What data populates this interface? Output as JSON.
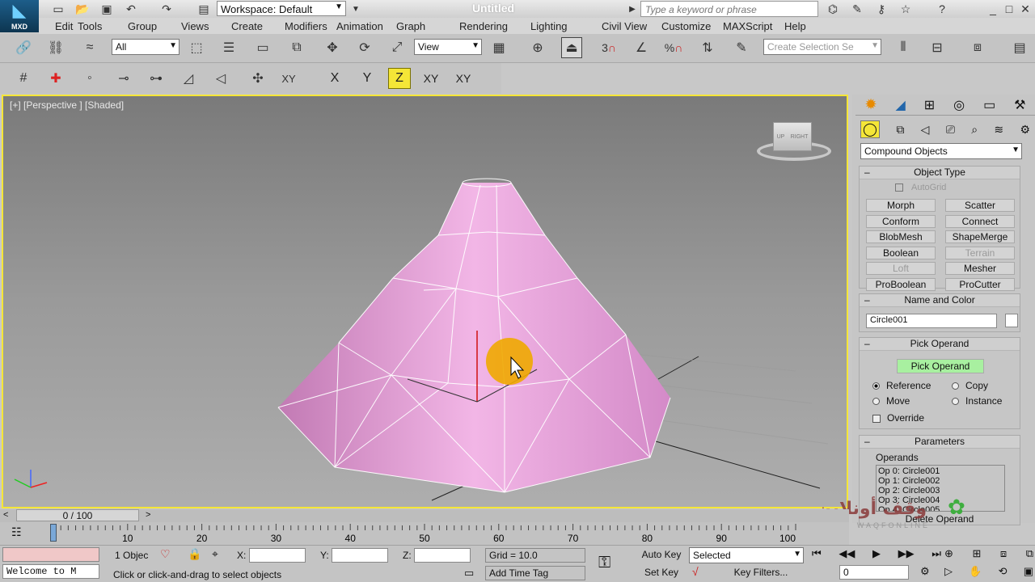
{
  "titlebar": {
    "app_badge": "MXD",
    "workspace": "Workspace: Default",
    "doc_title": "Untitled",
    "search_placeholder": "Type a keyword or phrase"
  },
  "menu": [
    "Edit",
    "Tools",
    "Group",
    "Views",
    "Create",
    "Modifiers",
    "Animation",
    "Graph Editors",
    "Rendering",
    "Lighting Analysis",
    "Civil View",
    "Customize",
    "MAXScript",
    "Help"
  ],
  "toolbar": {
    "filter_value": "All",
    "ref_coord_value": "View",
    "selection_set_placeholder": "Create Selection Se",
    "snap_label": "3",
    "percent_label": "%",
    "axes": [
      "X",
      "Y",
      "Z",
      "XY",
      "XY"
    ]
  },
  "viewport": {
    "label": "[+] [Perspective ] [Shaded]",
    "viewcube_labels": [
      "UP",
      "RIGHT"
    ]
  },
  "panel": {
    "category": "Compound Objects",
    "object_type": {
      "title": "Object Type",
      "autogrid": "AutoGrid",
      "buttons": [
        {
          "label": "Morph",
          "enabled": true
        },
        {
          "label": "Scatter",
          "enabled": true
        },
        {
          "label": "Conform",
          "enabled": true
        },
        {
          "label": "Connect",
          "enabled": true
        },
        {
          "label": "BlobMesh",
          "enabled": true
        },
        {
          "label": "ShapeMerge",
          "enabled": true
        },
        {
          "label": "Boolean",
          "enabled": true
        },
        {
          "label": "Terrain",
          "enabled": false
        },
        {
          "label": "Loft",
          "enabled": false
        },
        {
          "label": "Mesher",
          "enabled": true
        },
        {
          "label": "ProBoolean",
          "enabled": true
        },
        {
          "label": "ProCutter",
          "enabled": true
        }
      ]
    },
    "name_color": {
      "title": "Name and Color",
      "name": "Circle001",
      "color": "#ffffff"
    },
    "pick_operand": {
      "title": "Pick Operand",
      "button": "Pick Operand",
      "options": [
        "Reference",
        "Copy",
        "Move",
        "Instance"
      ],
      "selected": "Reference",
      "override": "Override"
    },
    "parameters": {
      "title": "Parameters",
      "operands_label": "Operands",
      "operands": [
        "Op 0: Circle001",
        "Op 1: Circle002",
        "Op 2: Circle003",
        "Op 3: Circle004",
        "Op 4: Circle005"
      ],
      "delete_button": "Delete Operand"
    },
    "accent_green": "#a8f0a0"
  },
  "timeline": {
    "frame_label": "0 / 100",
    "ticks": [
      "10",
      "20",
      "30",
      "40",
      "50",
      "60",
      "70",
      "80",
      "90",
      "100"
    ],
    "current_frame": 0
  },
  "status": {
    "maxscript": "Welcome to M",
    "objects": "1 Objec",
    "x_label": "X:",
    "y_label": "Y:",
    "z_label": "Z:",
    "grid": "Grid = 10.0",
    "prompt": "Click or click-and-drag to select objects",
    "add_time_tag": "Add Time Tag",
    "auto_key": "Auto Key",
    "set_key": "Set Key",
    "selected": "Selected",
    "key_filters": "Key Filters...",
    "frame_field": "0"
  },
  "watermark": {
    "arabic": "وقف أونلاين",
    "latin": "WAQFONLINE"
  },
  "colors": {
    "viewport_border": "#f5e637",
    "object_fill": "#e9a6dc",
    "cursor_highlight": "#f0a800"
  }
}
